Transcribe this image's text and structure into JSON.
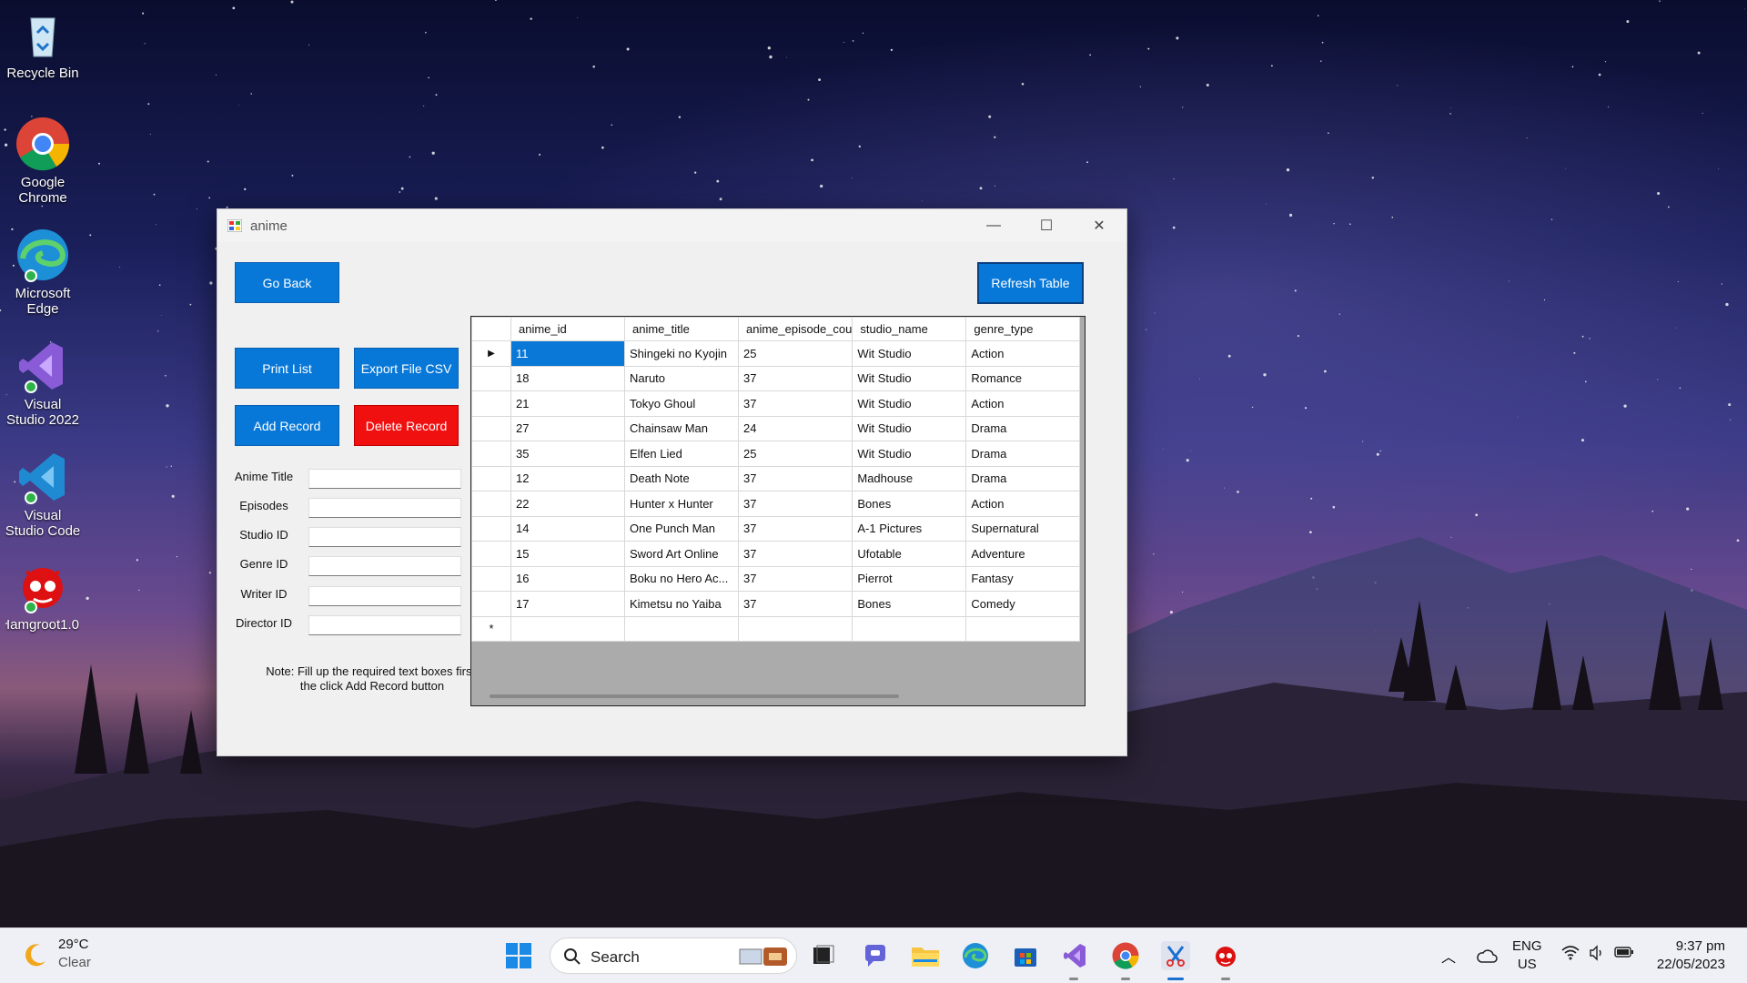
{
  "desktop": {
    "icons": [
      {
        "label": "Recycle Bin",
        "icon": "recycle-bin-icon"
      },
      {
        "label": "Google Chrome",
        "icon": "chrome-icon"
      },
      {
        "label": "Microsoft Edge",
        "icon": "edge-icon"
      },
      {
        "label": "Visual Studio 2022",
        "icon": "visual-studio-icon"
      },
      {
        "label": "Visual Studio Code",
        "icon": "vscode-icon"
      },
      {
        "label": "Iamgroot1.0",
        "icon": "iamgroot-app-icon"
      }
    ]
  },
  "window": {
    "title": "anime",
    "controls": {
      "minimize": "—",
      "maximize": "☐",
      "close": "✕"
    },
    "buttons": {
      "go_back": "Go Back",
      "refresh": "Refresh Table",
      "print": "Print List",
      "export": "Export File CSV",
      "add": "Add Record",
      "delete": "Delete Record"
    },
    "form": {
      "anime_title": "Anime Title",
      "episodes": "Episodes",
      "studio_id": "Studio ID",
      "genre_id": "Genre ID",
      "writer_id": "Writer ID",
      "director_id": "Director ID"
    },
    "note_line1": "Note: Fill up the required text boxes first,",
    "note_line2": "the click Add Record button",
    "grid": {
      "columns": [
        "anime_id",
        "anime_title",
        "anime_episode_cou",
        "studio_name",
        "genre_type"
      ],
      "rows": [
        [
          "11",
          "Shingeki no Kyojin",
          "25",
          "Wit Studio",
          "Action"
        ],
        [
          "18",
          "Naruto",
          "37",
          "Wit Studio",
          "Romance"
        ],
        [
          "21",
          "Tokyo Ghoul",
          "37",
          "Wit Studio",
          "Action"
        ],
        [
          "27",
          "Chainsaw Man",
          "24",
          "Wit Studio",
          "Drama"
        ],
        [
          "35",
          "Elfen Lied",
          "25",
          "Wit Studio",
          "Drama"
        ],
        [
          "12",
          "Death Note",
          "37",
          "Madhouse",
          "Drama"
        ],
        [
          "22",
          "Hunter x Hunter",
          "37",
          "Bones",
          "Action"
        ],
        [
          "14",
          "One Punch Man",
          "37",
          "A-1 Pictures",
          "Supernatural"
        ],
        [
          "15",
          "Sword Art Online",
          "37",
          "Ufotable",
          "Adventure"
        ],
        [
          "16",
          "Boku no Hero Ac...",
          "37",
          "Pierrot",
          "Fantasy"
        ],
        [
          "17",
          "Kimetsu no Yaiba",
          "37",
          "Bones",
          "Comedy"
        ]
      ],
      "current_row_marker": "▶",
      "new_row_marker": "*"
    }
  },
  "taskbar": {
    "weather_temp": "29°C",
    "weather_desc": "Clear",
    "search_label": "Search",
    "lang_1": "ENG",
    "lang_2": "US",
    "time": "9:37 pm",
    "date": "22/05/2023"
  },
  "colors": {
    "accent": "#0878d8",
    "danger": "#f01010",
    "selection": "#0a78d7"
  }
}
